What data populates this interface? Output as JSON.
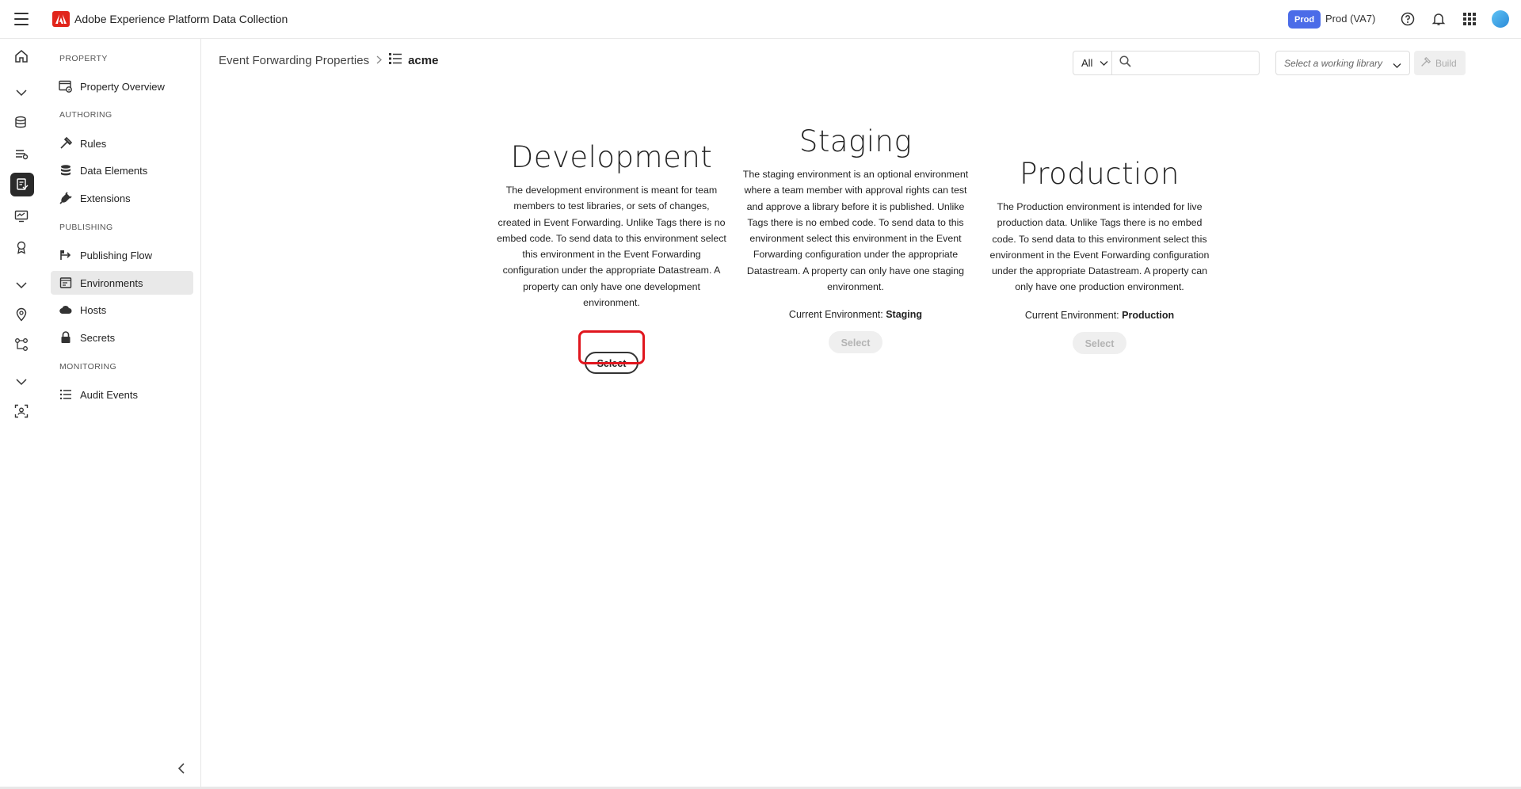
{
  "app": {
    "title": "Adobe Experience Platform Data Collection"
  },
  "topbar": {
    "badge": "Prod",
    "environment": "Prod (VA7)"
  },
  "sidenav": {
    "sections": {
      "property": "PROPERTY",
      "authoring": "AUTHORING",
      "publishing": "PUBLISHING",
      "monitoring": "MONITORING"
    },
    "items": [
      {
        "label": "Property Overview"
      },
      {
        "label": "Rules"
      },
      {
        "label": "Data Elements"
      },
      {
        "label": "Extensions"
      },
      {
        "label": "Publishing Flow"
      },
      {
        "label": "Environments"
      },
      {
        "label": "Hosts"
      },
      {
        "label": "Secrets"
      },
      {
        "label": "Audit Events"
      }
    ],
    "selected": "Environments"
  },
  "breadcrumb": {
    "parent": "Event Forwarding Properties",
    "current": "acme"
  },
  "toolbar": {
    "filter": "All",
    "search_placeholder": "",
    "library_placeholder": "Select a working library",
    "build_label": "Build"
  },
  "environments": [
    {
      "title": "Development",
      "description": "The development environment is meant for team members to test libraries, or sets of changes, created in Event Forwarding. Unlike Tags there is no embed code. To send data to this environment select this environment in the Event Forwarding configuration under the appropriate Datastream. A property can only have one development environment.",
      "current_label": "",
      "current_value": "",
      "button": "Select",
      "enabled": true
    },
    {
      "title": "Staging",
      "description": "The staging environment is an optional environment where a team member with approval rights can test and approve a library before it is published. Unlike Tags there is no embed code. To send data to this environment select this environment in the Event Forwarding configuration under the appropriate Datastream. A property can only have one staging environment.",
      "current_label": "Current Environment:",
      "current_value": "Staging",
      "button": "Select",
      "enabled": false
    },
    {
      "title": "Production",
      "description": "The Production environment is intended for live production data. Unlike Tags there is no embed code. To send data to this environment select this environment in the Event Forwarding configuration under the appropriate Datastream. A property can only have one production environment.",
      "current_label": "Current Environment:",
      "current_value": "Production",
      "button": "Select",
      "enabled": false
    }
  ],
  "colors": {
    "accent": "#4b6ce8",
    "highlight": "#e0161e",
    "brand": "#e1251b"
  }
}
